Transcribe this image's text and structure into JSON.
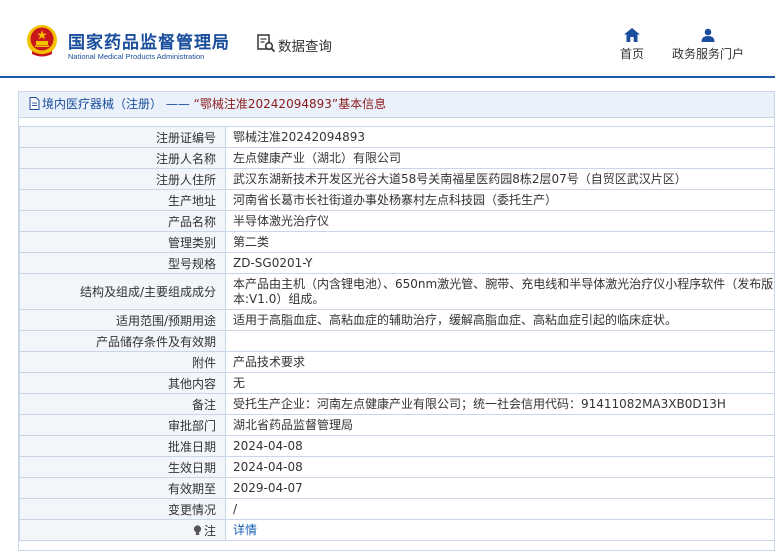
{
  "header": {
    "logo_cn": "国家药品监督管理局",
    "logo_en": "National Medical Products Administration",
    "subtitle": "数据查询",
    "nav": {
      "home_label": "首页",
      "portal_label": "政务服务门户"
    }
  },
  "panel": {
    "breadcrumb_category": "境内医疗器械（注册）",
    "breadcrumb_sep": "——",
    "breadcrumb_record": "“鄂械注准20242094893”基本信息"
  },
  "rows": [
    {
      "label": "注册证编号",
      "value": "鄂械注准20242094893"
    },
    {
      "label": "注册人名称",
      "value": "左点健康产业（湖北）有限公司"
    },
    {
      "label": "注册人住所",
      "value": "武汉东湖新技术开发区光谷大道58号关南福星医药园8栋2层07号（自贸区武汉片区）"
    },
    {
      "label": "生产地址",
      "value": "河南省长葛市长社街道办事处杨寨村左点科技园（委托生产）"
    },
    {
      "label": "产品名称",
      "value": "半导体激光治疗仪"
    },
    {
      "label": "管理类别",
      "value": "第二类"
    },
    {
      "label": "型号规格",
      "value": "ZD-SG0201-Y"
    },
    {
      "label": "结构及组成/主要组成成分",
      "value": "本产品由主机（内含锂电池）、650nm激光管、腕带、充电线和半导体激光治疗仪小程序软件（发布版本:V1.0）组成。"
    },
    {
      "label": "适用范围/预期用途",
      "value": "适用于高脂血症、高粘血症的辅助治疗，缓解高脂血症、高粘血症引起的临床症状。"
    },
    {
      "label": "产品储存条件及有效期",
      "value": ""
    },
    {
      "label": "附件",
      "value": "产品技术要求"
    },
    {
      "label": "其他内容",
      "value": "无"
    },
    {
      "label": "备注",
      "value": "受托生产企业：河南左点健康产业有限公司；统一社会信用代码：91411082MA3XB0D13H"
    },
    {
      "label": "审批部门",
      "value": "湖北省药品监督管理局"
    },
    {
      "label": "批准日期",
      "value": "2024-04-08"
    },
    {
      "label": "生效日期",
      "value": "2024-04-08"
    },
    {
      "label": "有效期至",
      "value": "2029-04-07"
    },
    {
      "label": "变更情况",
      "value": "/"
    }
  ],
  "note": {
    "label": "注",
    "link": "详情"
  },
  "colors": {
    "brand_blue": "#1a4e9c",
    "header_rule": "#1f5aa6",
    "border": "#c8d6e8",
    "title_bg": "#eaf1fa",
    "link": "#1a5fb4",
    "emblem_red": "#c8161d",
    "emblem_gold": "#f2c200"
  },
  "icons": {
    "emblem": "national-emblem-icon",
    "search": "search-document-icon",
    "home": "home-icon",
    "portal": "user-icon",
    "doc": "document-icon",
    "note": "lightbulb-icon"
  }
}
